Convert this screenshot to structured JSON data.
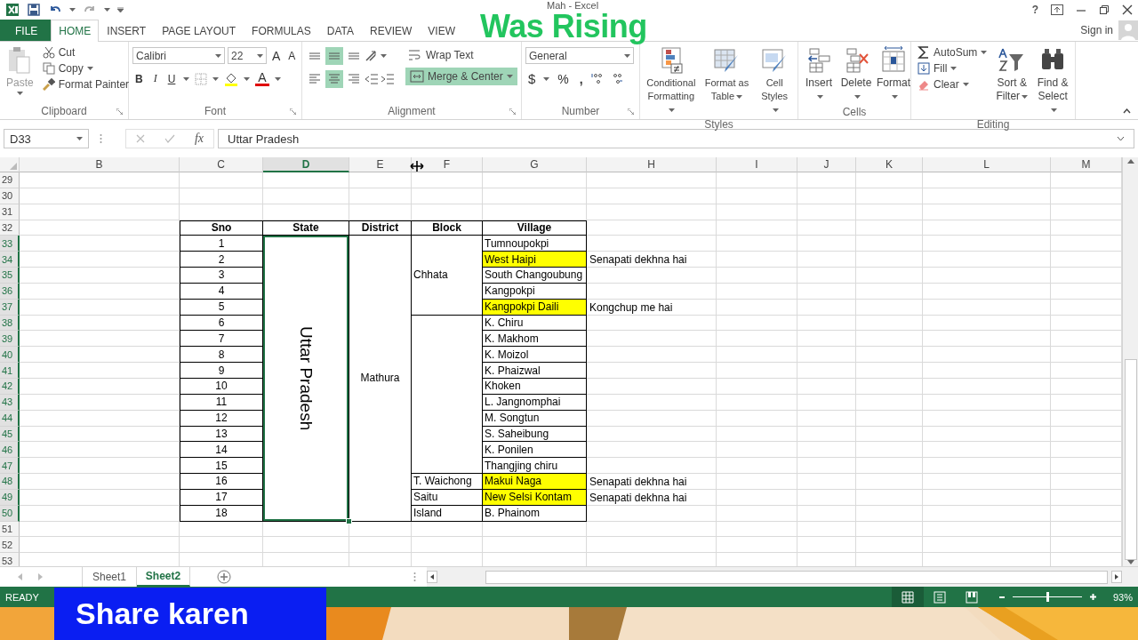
{
  "window": {
    "title": "Mah - Excel",
    "help": "?",
    "sign_in": "Sign in"
  },
  "tabs": [
    {
      "label": "FILE",
      "kind": "file",
      "selected": false
    },
    {
      "label": "HOME",
      "kind": "tab",
      "selected": true
    },
    {
      "label": "INSERT",
      "kind": "tab",
      "selected": false
    },
    {
      "label": "PAGE LAYOUT",
      "kind": "tab",
      "selected": false
    },
    {
      "label": "FORMULAS",
      "kind": "tab",
      "selected": false
    },
    {
      "label": "DATA",
      "kind": "tab",
      "selected": false
    },
    {
      "label": "REVIEW",
      "kind": "tab",
      "selected": false
    },
    {
      "label": "VIEW",
      "kind": "tab",
      "selected": false
    }
  ],
  "ribbon": {
    "groups": [
      {
        "kind": "clipboard",
        "label": "Clipboard",
        "launcher": true,
        "paste": {
          "label": "Paste",
          "disabled": true
        },
        "items": [
          "Cut",
          "Copy",
          "Format Painter"
        ]
      },
      {
        "kind": "font",
        "label": "Font",
        "launcher": true,
        "font_name": "Calibri",
        "font_size": "22",
        "grow": "A",
        "shrink": "A",
        "bold": "B",
        "italic": "I",
        "underline": "U",
        "font_color": "A"
      },
      {
        "kind": "alignment",
        "label": "Alignment",
        "launcher": true,
        "vertical_align": [
          {
            "selected": false
          },
          {
            "selected": true
          },
          {
            "selected": false
          }
        ],
        "horizontal_align": [
          {
            "selected": false
          },
          {
            "selected": true
          },
          {
            "selected": false
          }
        ],
        "wrap_text": {
          "label": "Wrap Text",
          "selected": false
        },
        "merge": {
          "label": "Merge & Center",
          "selected": true
        }
      },
      {
        "kind": "number",
        "label": "Number",
        "launcher": true,
        "format": "General",
        "currency": "$",
        "percent": "%",
        "comma": ","
      },
      {
        "kind": "styles",
        "label": "Styles",
        "items": [
          "Conditional Formatting",
          "Format as Table",
          "Cell Styles"
        ]
      },
      {
        "kind": "cells",
        "label": "Cells",
        "items": [
          "Insert",
          "Delete",
          "Format"
        ]
      },
      {
        "kind": "editing",
        "label": "Editing",
        "small_items": [
          "AutoSum",
          "Fill",
          "Clear"
        ],
        "large_items": [
          "Sort & Filter",
          "Find & Select"
        ]
      }
    ]
  },
  "formula_bar": {
    "name_box": "D33",
    "fx": "fx",
    "value": "Uttar Pradesh"
  },
  "sheet": {
    "columns": [
      {
        "label": "B",
        "selected": false
      },
      {
        "label": "C",
        "selected": false
      },
      {
        "label": "D",
        "selected": true
      },
      {
        "label": "E",
        "selected": false
      },
      {
        "label": "F",
        "selected": false
      },
      {
        "label": "G",
        "selected": false
      },
      {
        "label": "H",
        "selected": false
      },
      {
        "label": "I",
        "selected": false
      },
      {
        "label": "J",
        "selected": false
      },
      {
        "label": "K",
        "selected": false
      },
      {
        "label": "L",
        "selected": false
      },
      {
        "label": "M",
        "selected": false
      }
    ],
    "rows": [
      {
        "label": "29",
        "selected": false
      },
      {
        "label": "30",
        "selected": false
      },
      {
        "label": "31",
        "selected": false
      },
      {
        "label": "32",
        "selected": false
      },
      {
        "label": "33",
        "selected": true
      },
      {
        "label": "34",
        "selected": true
      },
      {
        "label": "35",
        "selected": true
      },
      {
        "label": "36",
        "selected": true
      },
      {
        "label": "37",
        "selected": true
      },
      {
        "label": "38",
        "selected": true
      },
      {
        "label": "39",
        "selected": true
      },
      {
        "label": "40",
        "selected": true
      },
      {
        "label": "41",
        "selected": true
      },
      {
        "label": "42",
        "selected": true
      },
      {
        "label": "43",
        "selected": true
      },
      {
        "label": "44",
        "selected": true
      },
      {
        "label": "45",
        "selected": true
      },
      {
        "label": "46",
        "selected": true
      },
      {
        "label": "47",
        "selected": true
      },
      {
        "label": "48",
        "selected": true
      },
      {
        "label": "49",
        "selected": true
      },
      {
        "label": "50",
        "selected": true
      },
      {
        "label": "51",
        "selected": false
      },
      {
        "label": "52",
        "selected": false
      },
      {
        "label": "53",
        "selected": false
      }
    ],
    "table": {
      "headers": [
        "Sno",
        "State",
        "District",
        "Block",
        "Village"
      ],
      "state": {
        "text": "Uttar Pradesh",
        "selected": true
      },
      "district": "Mathura",
      "blocks": [
        {
          "name": "Chhata",
          "villages": [
            {
              "sno": "1",
              "name": "Tumnoupokpi",
              "highlighted": false
            },
            {
              "sno": "2",
              "name": "West Haipi",
              "highlighted": true,
              "note": "Senapati dekhna hai"
            },
            {
              "sno": "3",
              "name": "South Changoubung",
              "highlighted": false
            },
            {
              "sno": "4",
              "name": "Kangpokpi",
              "highlighted": false
            },
            {
              "sno": "5",
              "name": "Kangpokpi Daili",
              "highlighted": true,
              "note": "Kongchup me hai"
            }
          ]
        },
        {
          "villages": [
            {
              "sno": "6",
              "name": "K. Chiru",
              "highlighted": false
            },
            {
              "sno": "7",
              "name": "K. Makhom",
              "highlighted": false
            },
            {
              "sno": "8",
              "name": "K. Moizol",
              "highlighted": false
            },
            {
              "sno": "9",
              "name": "K. Phaizwal",
              "highlighted": false
            },
            {
              "sno": "10",
              "name": "Khoken",
              "highlighted": false
            },
            {
              "sno": "11",
              "name": "L. Jangnomphai",
              "highlighted": false
            },
            {
              "sno": "12",
              "name": "M. Songtun",
              "highlighted": false
            },
            {
              "sno": "13",
              "name": "S. Saheibung",
              "highlighted": false
            },
            {
              "sno": "14",
              "name": "K. Ponilen",
              "highlighted": false
            },
            {
              "sno": "15",
              "name": "Thangjing chiru",
              "highlighted": false
            }
          ]
        },
        {
          "name": "T. Waichong",
          "villages": [
            {
              "sno": "16",
              "name": "Makui Naga",
              "highlighted": true,
              "note": "Senapati dekhna hai"
            }
          ]
        },
        {
          "name": "Saitu",
          "villages": [
            {
              "sno": "17",
              "name": "New Selsi Kontam",
              "highlighted": true,
              "note": "Senapati dekhna hai"
            }
          ]
        },
        {
          "name": "Island",
          "villages": [
            {
              "sno": "18",
              "name": "B. Phainom",
              "highlighted": false
            }
          ]
        }
      ]
    }
  },
  "sheet_tabs": [
    {
      "label": "Sheet1",
      "selected": false
    },
    {
      "label": "Sheet2",
      "selected": true
    }
  ],
  "status_bar": {
    "status": "READY",
    "views": [
      {
        "selected": true
      },
      {
        "selected": false
      },
      {
        "selected": false
      }
    ],
    "zoom": {
      "level": 0.5
    },
    "zoom_label": "93%"
  },
  "overlays": [
    {
      "kind": "channel",
      "text": "Was Rising"
    },
    {
      "kind": "banner",
      "text": "Share karen"
    }
  ]
}
